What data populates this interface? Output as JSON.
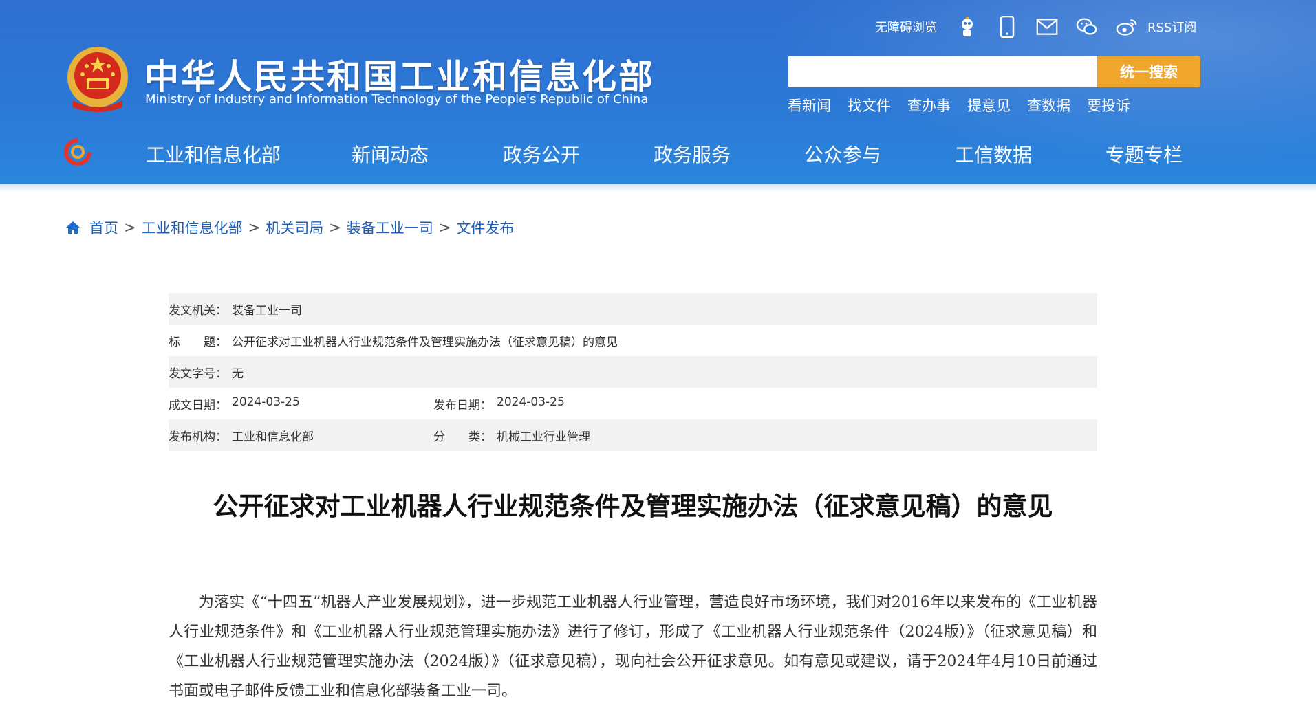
{
  "header": {
    "site_name_cn": "中华人民共和国工业和信息化部",
    "site_name_en": "Ministry of Industry and Information Technology of the People's Republic of China",
    "top_links": {
      "accessibility": "无障碍浏览",
      "rss": "RSS订阅",
      "icons": [
        "robot-assistant-icon",
        "mobile-icon",
        "mail-icon",
        "wechat-icon",
        "weibo-icon"
      ]
    },
    "search": {
      "placeholder": "",
      "button": "统一搜索"
    },
    "quick_links": [
      "看新闻",
      "找文件",
      "查办事",
      "提意见",
      "查数据",
      "要投诉"
    ],
    "nav": [
      "工业和信息化部",
      "新闻动态",
      "政务公开",
      "政务服务",
      "公众参与",
      "工信数据",
      "专题专栏"
    ],
    "colors": {
      "header_bg": "#2c78d6",
      "search_button": "#f0a52b",
      "link": "#1f5fb8"
    }
  },
  "breadcrumb": [
    "首页",
    "工业和信息化部",
    "机关司局",
    "装备工业一司",
    "文件发布"
  ],
  "meta": {
    "issuer_label": "发文机关：",
    "issuer": "装备工业一司",
    "title_label": "标　　题：",
    "title": "公开征求对工业机器人行业规范条件及管理实施办法（征求意见稿）的意见",
    "doc_no_label": "发文字号：",
    "doc_no": "无",
    "created_label": "成文日期：",
    "created": "2024-03-25",
    "published_label": "发布日期：",
    "published": "2024-03-25",
    "org_label": "发布机构：",
    "org": "工业和信息化部",
    "category_label": "分　　类：",
    "category": "机械工业行业管理"
  },
  "article": {
    "title": "公开征求对工业机器人行业规范条件及管理实施办法（征求意见稿）的意见",
    "body": "为落实《“十四五”机器人产业发展规划》，进一步规范工业机器人行业管理，营造良好市场环境，我们对2016年以来发布的《工业机器人行业规范条件》和《工业机器人行业规范管理实施办法》进行了修订，形成了《工业机器人行业规范条件（2024版）》（征求意见稿）和《工业机器人行业规范管理实施办法（2024版）》（征求意见稿），现向社会公开征求意见。如有意见或建议，请于2024年4月10日前通过书面或电子邮件反馈工业和信息化部装备工业一司。"
  }
}
